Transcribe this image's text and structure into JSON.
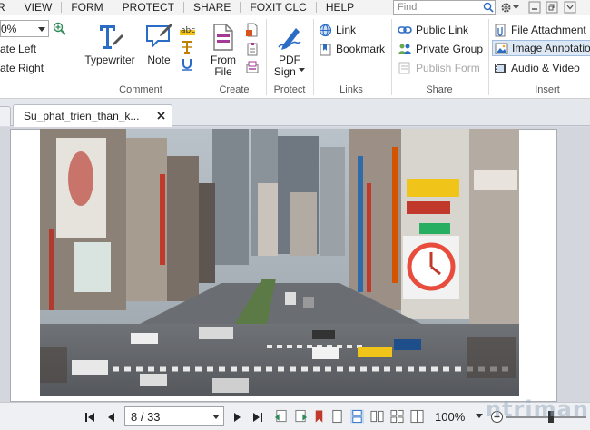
{
  "menu": {
    "items": [
      "VIEW",
      "FORM",
      "PROTECT",
      "SHARE",
      "FOXIT CLC",
      "HELP"
    ],
    "first_fragment": "R",
    "find_placeholder": "Find"
  },
  "ribbon": {
    "zoom_value": "0%",
    "rotate_left": "ate Left",
    "rotate_right": "ate Right",
    "comment": {
      "typewriter": "Typewriter",
      "note": "Note",
      "label": "Comment"
    },
    "create": {
      "from_file_line1": "From",
      "from_file_line2": "File",
      "label": "Create"
    },
    "protect": {
      "pdf_sign_line1": "PDF",
      "pdf_sign_line2": "Sign",
      "label": "Protect"
    },
    "links": {
      "link": "Link",
      "bookmark": "Bookmark",
      "label": "Links"
    },
    "share": {
      "public_link": "Public Link",
      "private_group": "Private Group",
      "publish_form": "Publish Form",
      "label": "Share"
    },
    "insert": {
      "file_attachment": "File Attachment",
      "image_annotation": "Image Annotatio",
      "audio_video": "Audio & Video",
      "label": "Insert"
    }
  },
  "tabs": {
    "active_tab": "Su_phat_trien_than_k..."
  },
  "statusbar": {
    "page_indicator": "8 / 33",
    "zoom": "100%"
  },
  "watermark": "ntrimane",
  "colors": {
    "accent_blue": "#2b6cc4",
    "ribbon_bg": "#ffffff",
    "menu_bg": "#f3f3f3",
    "statusbar_bg": "#eef0f3"
  }
}
